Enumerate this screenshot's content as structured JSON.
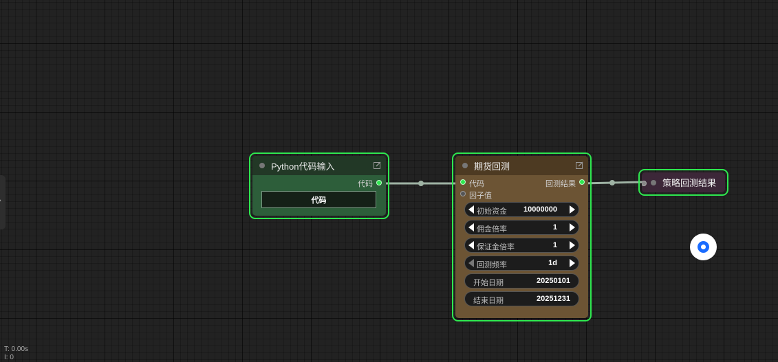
{
  "nodes": {
    "python": {
      "title": "Python代码输入",
      "output_label": "代码",
      "code_button": "代码"
    },
    "futures": {
      "title": "期货回测",
      "inputs": [
        "代码",
        "因子值"
      ],
      "output_label": "回测结果",
      "widgets": [
        {
          "label": "初始资金",
          "value": "10000000"
        },
        {
          "label": "佣金倍率",
          "value": "1"
        },
        {
          "label": "保证金倍率",
          "value": "1"
        },
        {
          "label": "回测频率",
          "value": "1d"
        }
      ],
      "date_fields": [
        {
          "label": "开始日期",
          "value": "20250101"
        },
        {
          "label": "结束日期",
          "value": "20251231"
        }
      ]
    },
    "result": {
      "title": "策略回测结果"
    }
  },
  "side_tab": {
    "arrow": "›"
  },
  "stats": {
    "time": "T: 0.00s",
    "iterations": "I: 0"
  },
  "colors": {
    "canvas": "#222222",
    "selected_outline": "#2ee84f",
    "link": "#9fb3a4",
    "python_node": "#2d5e3a",
    "futures_node": "#6c5434",
    "result_node": "#3c2738",
    "float_button": "#1a6cff"
  },
  "icons": {
    "edit": "edit-icon",
    "float": "chat-assistant-icon"
  }
}
